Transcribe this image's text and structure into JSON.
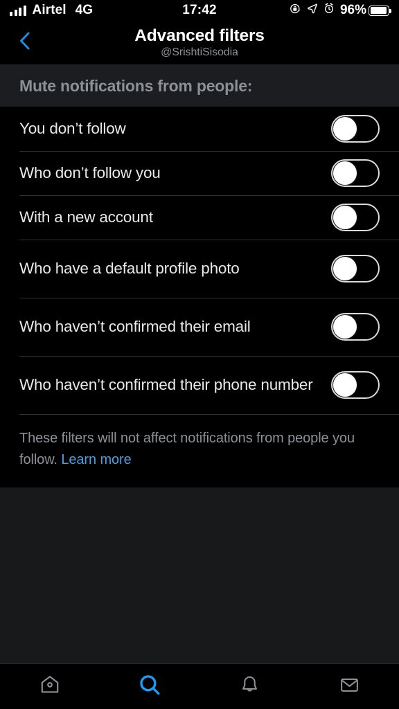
{
  "status_bar": {
    "carrier": "Airtel",
    "network": "4G",
    "time": "17:42",
    "battery_percent": "96%",
    "battery_level": 96,
    "icons": [
      "signal-bars-icon",
      "rotation-lock-icon",
      "location-arrow-icon",
      "alarm-clock-icon",
      "battery-icon"
    ]
  },
  "nav": {
    "back_icon": "chevron-left-icon",
    "title": "Advanced filters",
    "subtitle": "@SrishtiSisodia",
    "accent_color": "#1d9bf0"
  },
  "section": {
    "header": "Mute notifications from people:"
  },
  "filters": [
    {
      "label": "You don’t follow",
      "enabled": false
    },
    {
      "label": "Who don’t follow you",
      "enabled": false
    },
    {
      "label": "With a new account",
      "enabled": false
    },
    {
      "label": "Who have a default profile photo",
      "enabled": false
    },
    {
      "label": "Who haven’t confirmed their email",
      "enabled": false
    },
    {
      "label": "Who haven’t confirmed their phone number",
      "enabled": false
    }
  ],
  "footer": {
    "note": "These filters will not affect notifications from people you follow. ",
    "link": "Learn more",
    "link_color": "#4a9fe0"
  },
  "tabbar": {
    "items": [
      {
        "name": "home",
        "icon": "home-icon",
        "active": false
      },
      {
        "name": "search",
        "icon": "search-icon",
        "active": true
      },
      {
        "name": "notifications",
        "icon": "bell-icon",
        "active": false
      },
      {
        "name": "messages",
        "icon": "envelope-icon",
        "active": false
      }
    ],
    "active_color": "#1d9bf0",
    "inactive_color": "#8b9197"
  }
}
